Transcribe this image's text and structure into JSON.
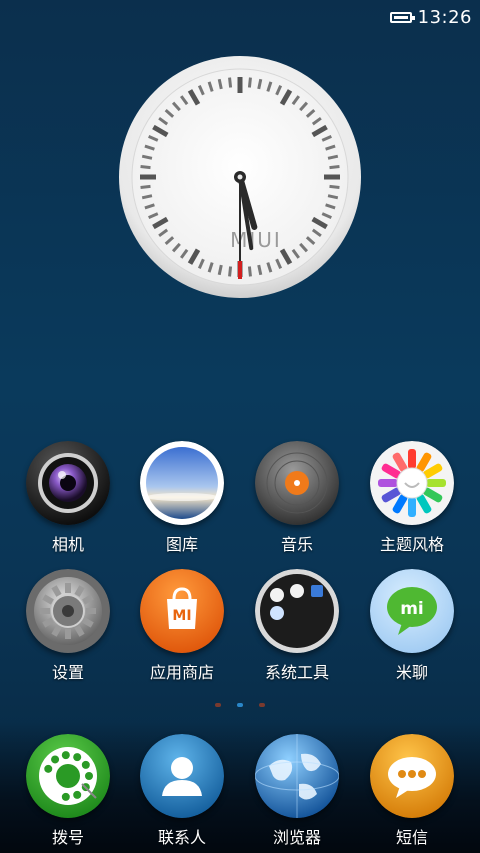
{
  "status_bar": {
    "time": "13:26",
    "battery_icon": "battery-full-icon"
  },
  "clock_widget": {
    "brand": "MIUI",
    "hour": 5,
    "minute": 28,
    "second": 30
  },
  "pager": {
    "page_count": 3,
    "active_page": 2
  },
  "apps": [
    {
      "label": "相机",
      "icon": "camera-icon"
    },
    {
      "label": "图库",
      "icon": "gallery-icon"
    },
    {
      "label": "音乐",
      "icon": "music-icon"
    },
    {
      "label": "主题风格",
      "icon": "theme-icon"
    },
    {
      "label": "设置",
      "icon": "settings-icon"
    },
    {
      "label": "应用商店",
      "icon": "app-store-icon"
    },
    {
      "label": "系统工具",
      "icon": "system-tools-icon"
    },
    {
      "label": "米聊",
      "icon": "miliao-icon"
    }
  ],
  "dock": [
    {
      "label": "拨号",
      "icon": "dialer-icon"
    },
    {
      "label": "联系人",
      "icon": "contacts-icon"
    },
    {
      "label": "浏览器",
      "icon": "browser-icon"
    },
    {
      "label": "短信",
      "icon": "messages-icon"
    }
  ]
}
